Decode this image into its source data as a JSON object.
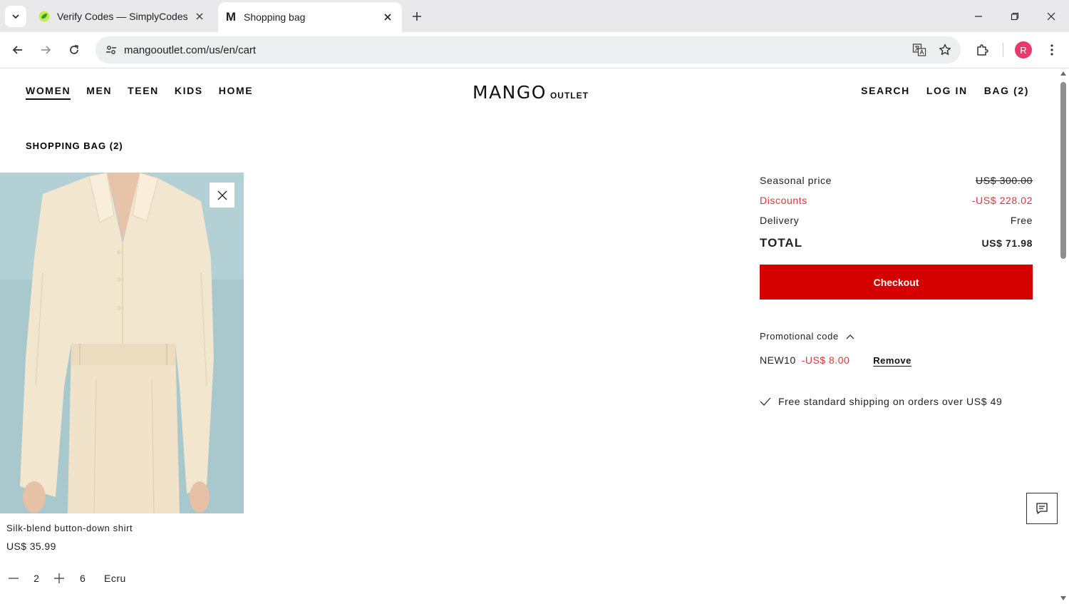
{
  "browser": {
    "tabs": [
      {
        "title": "Verify Codes — SimplyCodes",
        "favicon": "simplycodes-leaf-icon"
      },
      {
        "title": "Shopping bag",
        "favicon": "mango-m-icon",
        "favicon_letter": "M"
      }
    ],
    "url": "mangooutlet.com/us/en/cart",
    "profile_initial": "R",
    "colors": {
      "tabbar": "#e9e9ec",
      "avatar": "#e8386e"
    }
  },
  "nav": {
    "categories": [
      "WOMEN",
      "MEN",
      "TEEN",
      "KIDS",
      "HOME"
    ],
    "active_category": "WOMEN",
    "logo_main": "MANGO",
    "logo_sub": "OUTLET",
    "search": "SEARCH",
    "login": "LOG IN",
    "bag": "BAG (2)"
  },
  "cart": {
    "title": "SHOPPING BAG (2)",
    "item": {
      "name": "Silk-blend button-down shirt",
      "price": "US$ 35.99",
      "quantity": "2",
      "size": "6",
      "color": "Ecru"
    }
  },
  "summary": {
    "seasonal_label": "Seasonal price",
    "seasonal_value": "US$ 300.00",
    "discount_label": "Discounts",
    "discount_value": "-US$ 228.02",
    "delivery_label": "Delivery",
    "delivery_value": "Free",
    "total_label": "TOTAL",
    "total_value": "US$ 71.98",
    "checkout_label": "Checkout",
    "promo_label": "Promotional code",
    "promo_code": "NEW10",
    "promo_amount": "-US$ 8.00",
    "promo_remove": "Remove",
    "shipping_note": "Free standard shipping on orders over US$ 49",
    "colors": {
      "checkout": "#d50000",
      "discount": "#e2323a"
    }
  }
}
